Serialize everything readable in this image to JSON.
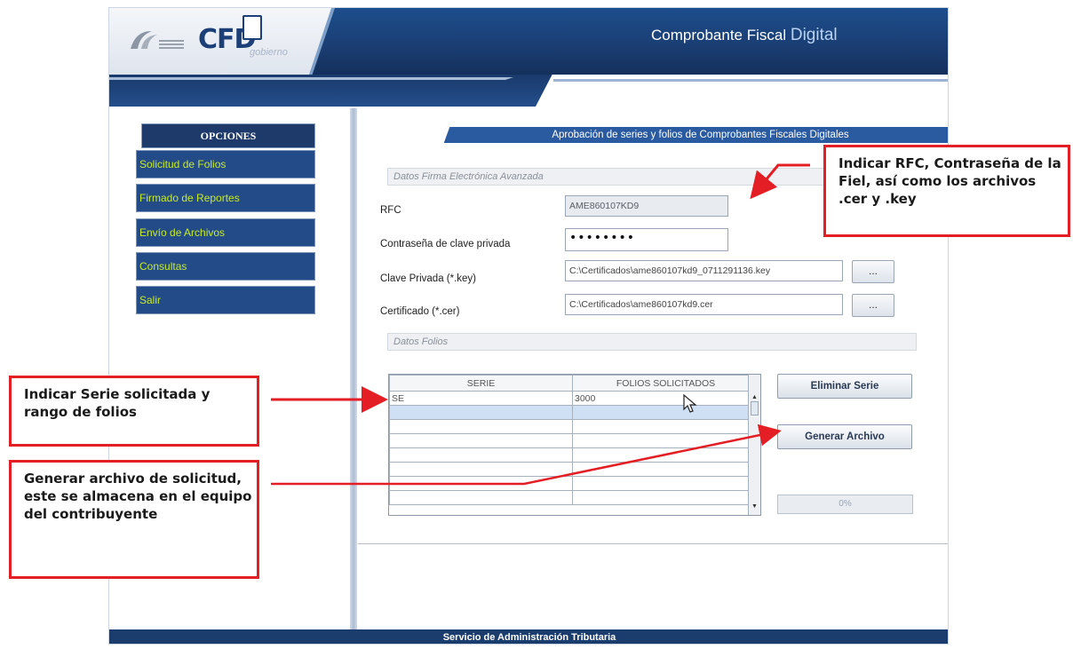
{
  "header": {
    "logo_text": "CFD",
    "logo_tagline": "gobierno",
    "title_main": "Comprobante Fiscal ",
    "title_accent": "Digital"
  },
  "sidebar": {
    "heading": "OPCIONES",
    "items": [
      {
        "label": "Solicitud de Folios"
      },
      {
        "label": "Firmado de Reportes"
      },
      {
        "label": "Envío de Archivos"
      },
      {
        "label": "Consultas"
      },
      {
        "label": "Salir"
      }
    ]
  },
  "main": {
    "section_title": "Aprobación de series y folios de Comprobantes Fiscales Digitales",
    "fiel_group": "Datos Firma Electrónica Avanzada",
    "rfc_label": "RFC",
    "rfc_value": "AME860107KD9",
    "password_label": "Contraseña de clave privada",
    "password_value": "••••••••",
    "key_label": "Clave Privada (*.key)",
    "key_value": "C:\\Certificados\\ame860107kd9_0711291136.key",
    "cert_label": "Certificado (*.cer)",
    "cert_value": "C:\\Certificados\\ame860107kd9.cer",
    "browse_label": "...",
    "folios_group": "Datos Folios",
    "grid": {
      "columns": [
        "SERIE",
        "FOLIOS SOLICITADOS"
      ],
      "rows": [
        [
          "SE",
          "3000"
        ],
        [
          "",
          ""
        ],
        [
          "",
          ""
        ],
        [
          "",
          ""
        ],
        [
          "",
          ""
        ],
        [
          "",
          ""
        ],
        [
          "",
          ""
        ],
        [
          "",
          ""
        ]
      ]
    },
    "btn_delete": "Eliminar Serie",
    "btn_generate": "Generar Archivo",
    "progress": "0%"
  },
  "footer": {
    "text": "Servicio de Administración Tributaria"
  },
  "annotations": {
    "rfc_callout": "Indicar RFC, Contraseña de la Fiel, así como los archivos .cer y .key",
    "serie_callout": "Indicar Serie solicitada y rango de folios",
    "generate_callout": "Generar archivo de solicitud, este se almacena en el equipo del contribuyente"
  },
  "colors": {
    "header_blue": "#1a3d72",
    "menu_text": "#c6ea2a",
    "callout_border": "#e31e24"
  }
}
